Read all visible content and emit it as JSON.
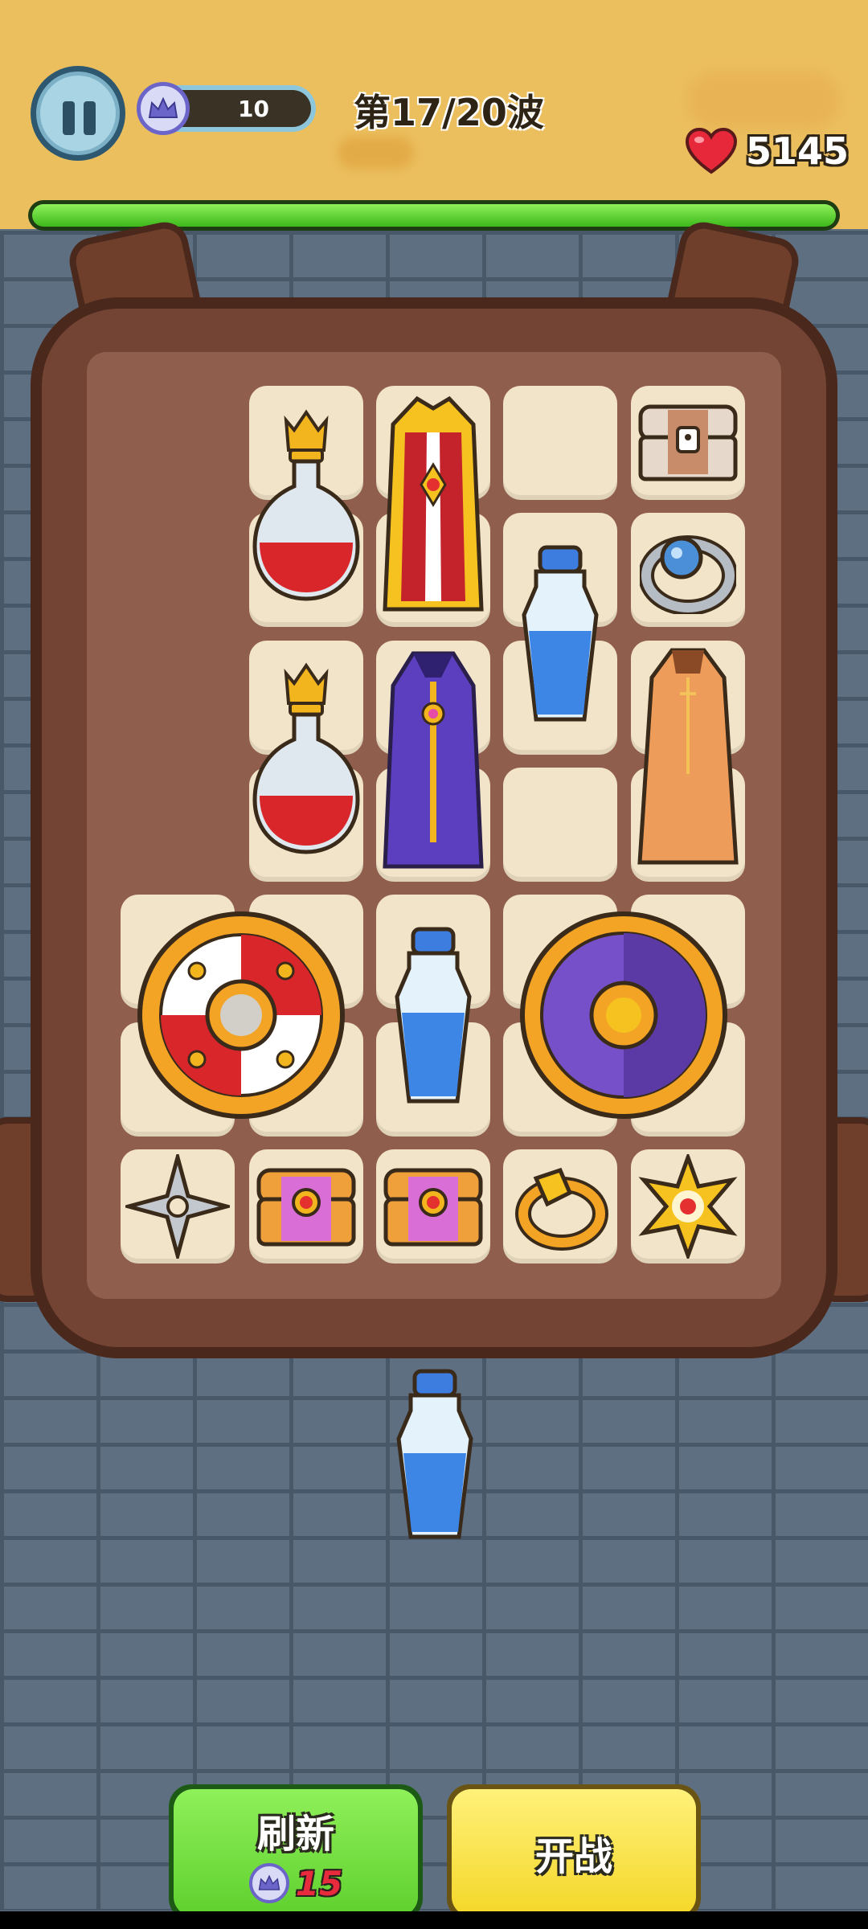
{
  "hud": {
    "gem_count": "10",
    "wave_text": "第17/20波",
    "hp": "5145",
    "wave_progress": 1.0
  },
  "backpack": {
    "items": [
      {
        "name": "red-potion-icon"
      },
      {
        "name": "golden-robe-icon"
      },
      {
        "name": "treasure-chest-icon"
      },
      {
        "name": "blue-gem-ring-icon"
      },
      {
        "name": "blue-potion-icon"
      },
      {
        "name": "red-potion-icon"
      },
      {
        "name": "purple-cloak-icon"
      },
      {
        "name": "orange-cloak-icon"
      },
      {
        "name": "red-white-shield-icon"
      },
      {
        "name": "blue-potion-icon"
      },
      {
        "name": "purple-shield-icon"
      },
      {
        "name": "shuriken-icon"
      },
      {
        "name": "pink-chest-icon"
      },
      {
        "name": "pink-chest-icon"
      },
      {
        "name": "gold-ring-icon"
      },
      {
        "name": "gold-star-icon"
      }
    ],
    "held_item": {
      "name": "blue-potion-icon"
    }
  },
  "buttons": {
    "refresh_label": "刷新",
    "refresh_cost": "15",
    "fight_label": "开战"
  },
  "colors": {
    "topbar": "#ecbf5e",
    "progress_green": "#3db81c",
    "backpack_brown": "#734433",
    "wall_blue": "#5e6f82"
  }
}
